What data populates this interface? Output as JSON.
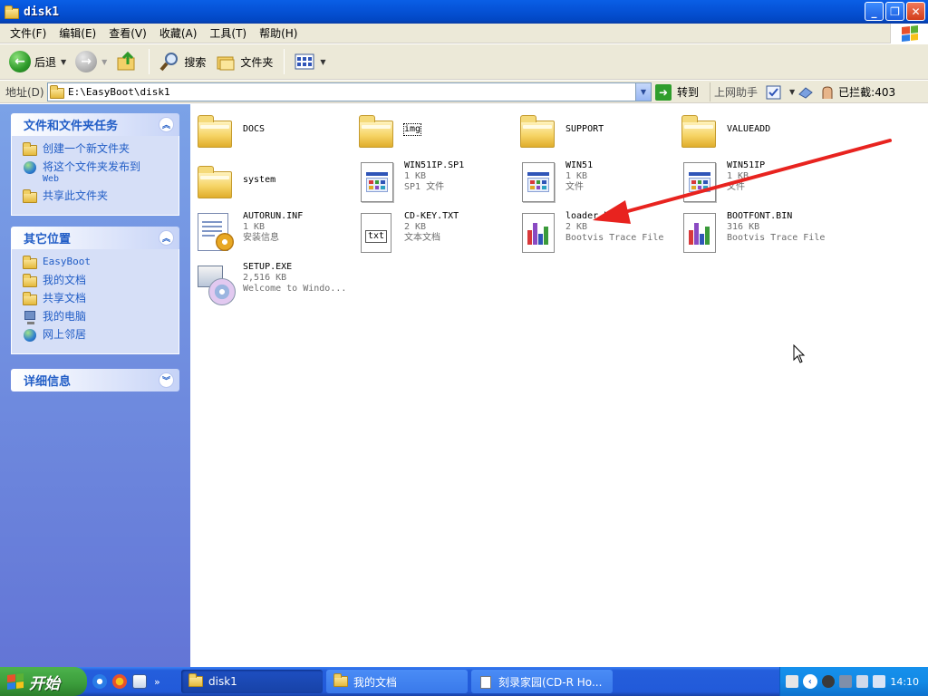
{
  "window": {
    "title": "disk1"
  },
  "menu": [
    "文件(F)",
    "编辑(E)",
    "查看(V)",
    "收藏(A)",
    "工具(T)",
    "帮助(H)"
  ],
  "toolbar": {
    "back": "后退",
    "search": "搜索",
    "folders": "文件夹"
  },
  "address": {
    "label": "地址(D)",
    "value": "E:\\EasyBoot\\disk1",
    "go": "转到",
    "helper": "上网助手",
    "blocked": "已拦截:403"
  },
  "left": {
    "tasks": {
      "title": "文件和文件夹任务",
      "items": [
        "创建一个新文件夹",
        "将这个文件夹发布到",
        "Web",
        "共享此文件夹"
      ]
    },
    "places": {
      "title": "其它位置",
      "items": [
        "EasyBoot",
        "我的文档",
        "共享文档",
        "我的电脑",
        "网上邻居"
      ]
    },
    "details": {
      "title": "详细信息"
    }
  },
  "files": [
    {
      "name": "DOCS",
      "type": "folder"
    },
    {
      "name": "img",
      "type": "folder"
    },
    {
      "name": "SUPPORT",
      "type": "folder"
    },
    {
      "name": "VALUEADD",
      "type": "folder"
    },
    {
      "name": "system",
      "type": "folder"
    },
    {
      "name": "WIN51IP.SP1",
      "size": "1 KB",
      "desc": "SP1 文件",
      "type": "app"
    },
    {
      "name": "WIN51",
      "size": "1 KB",
      "desc": "文件",
      "type": "app"
    },
    {
      "name": "WIN51IP",
      "size": "1 KB",
      "desc": "文件",
      "type": "app"
    },
    {
      "name": "AUTORUN.INF",
      "size": "1 KB",
      "desc": "安装信息",
      "type": "inf"
    },
    {
      "name": "CD-KEY.TXT",
      "size": "2 KB",
      "desc": "文本文档",
      "type": "txt"
    },
    {
      "name": "loader.bin",
      "size": "2 KB",
      "desc": "Bootvis Trace File",
      "type": "chart"
    },
    {
      "name": "BOOTFONT.BIN",
      "size": "316 KB",
      "desc": "Bootvis Trace File",
      "type": "chart"
    },
    {
      "name": "SETUP.EXE",
      "size": "2,516 KB",
      "desc": "Welcome to Windo...",
      "type": "setup"
    }
  ],
  "txt_icon_label": "txt",
  "taskbar": {
    "start": "开始",
    "tasks": [
      "disk1",
      "我的文档",
      "刻录家园(CD-R Ho..."
    ],
    "clock": "14:10"
  },
  "colors": {
    "arrow": "#e8231f",
    "title_bar": "#0653d8",
    "task_pane": "#7ba2e7"
  }
}
